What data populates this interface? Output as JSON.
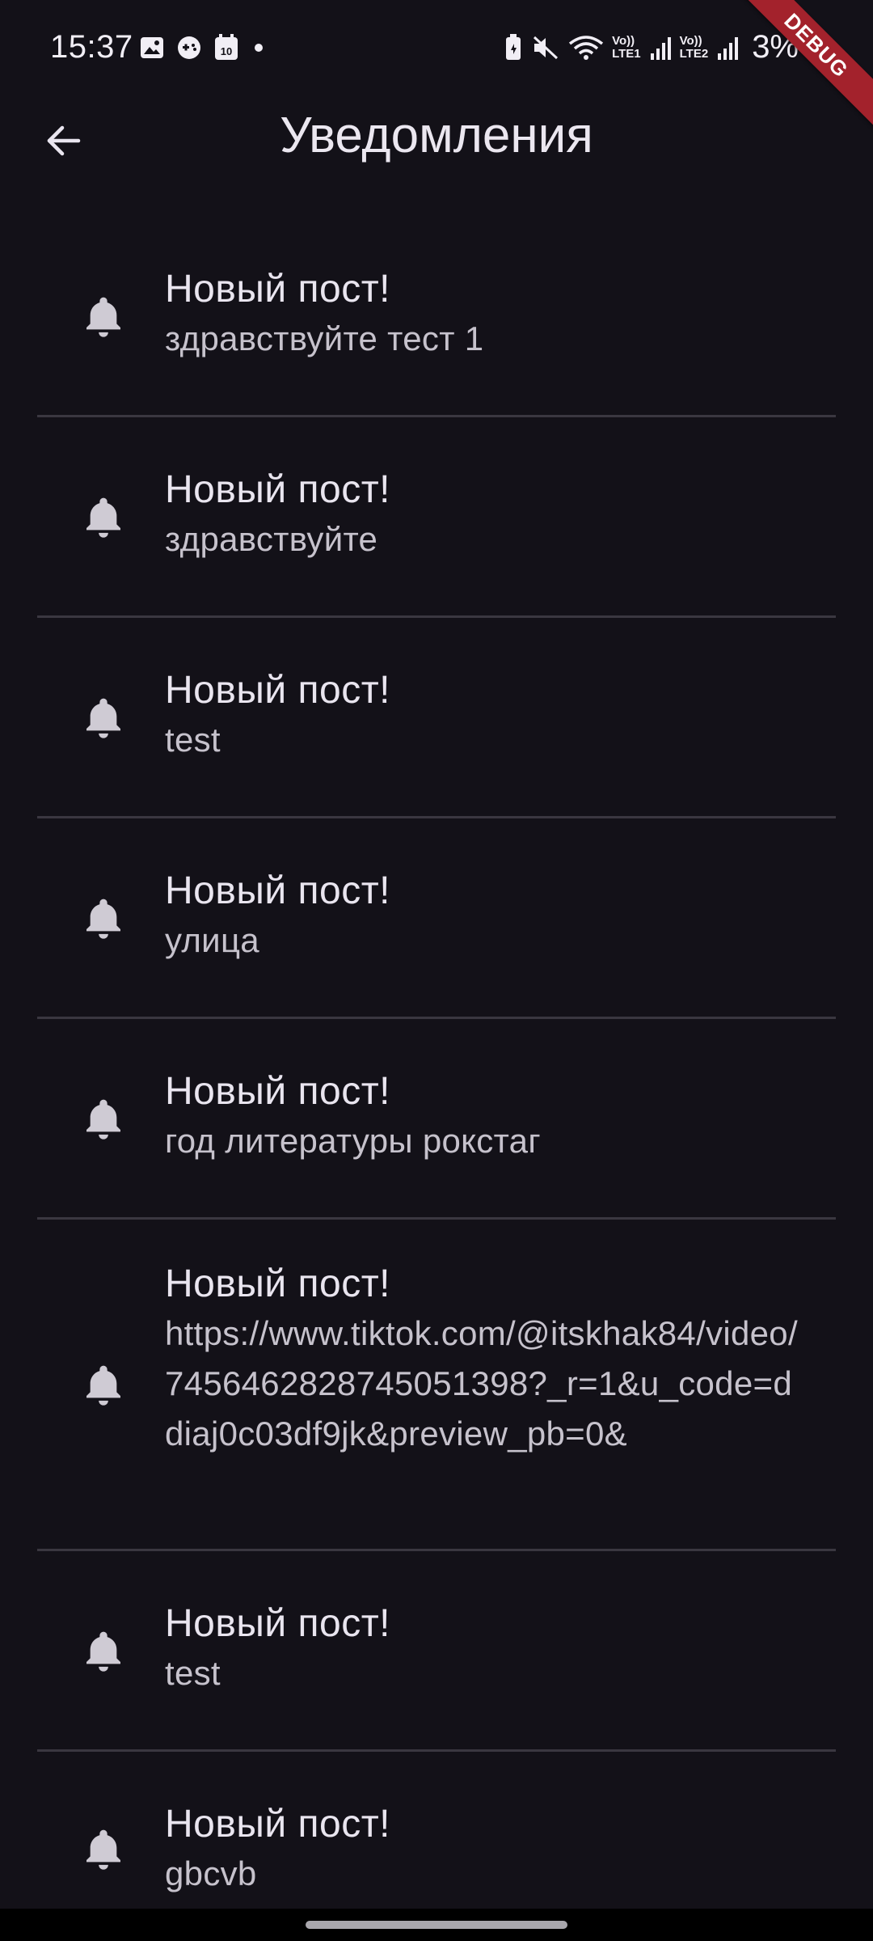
{
  "status_bar": {
    "time": "15:37",
    "notification_icons": [
      "gallery-icon",
      "game-controller-icon",
      "calendar-icon",
      "dot-icon"
    ],
    "calendar_day": "10",
    "lte1": [
      "Vo))",
      "LTE1"
    ],
    "lte2": [
      "Vo))",
      "LTE2"
    ],
    "battery": "3%"
  },
  "debug_banner": "DEBUG",
  "app_bar": {
    "title": "Уведомления",
    "back_icon": "arrow-back-icon"
  },
  "notifications": [
    {
      "title": "Новый пост!",
      "subtitle": "здравствуйте тест 1"
    },
    {
      "title": "Новый пост!",
      "subtitle": "здравствуйте"
    },
    {
      "title": "Новый пост!",
      "subtitle": "test"
    },
    {
      "title": "Новый пост!",
      "subtitle": "улица"
    },
    {
      "title": "Новый пост!",
      "subtitle": "год литературы рокстаг"
    },
    {
      "title": "Новый пост!",
      "subtitle": "https://www.tiktok.com/@itskhak84/video/7456462828745051398?_r=1&u_code=ddiaj0c03df9jk&preview_pb=0&"
    },
    {
      "title": "Новый пост!",
      "subtitle": "test"
    },
    {
      "title": "Новый пост!",
      "subtitle": "gbcvb"
    }
  ],
  "colors": {
    "background": "#131118",
    "text_primary": "#e9e5ef",
    "text_secondary": "#c6c2cc",
    "divider": "#3a3740",
    "icon": "#cfcbd4",
    "debug_ribbon": "#a3222c"
  }
}
